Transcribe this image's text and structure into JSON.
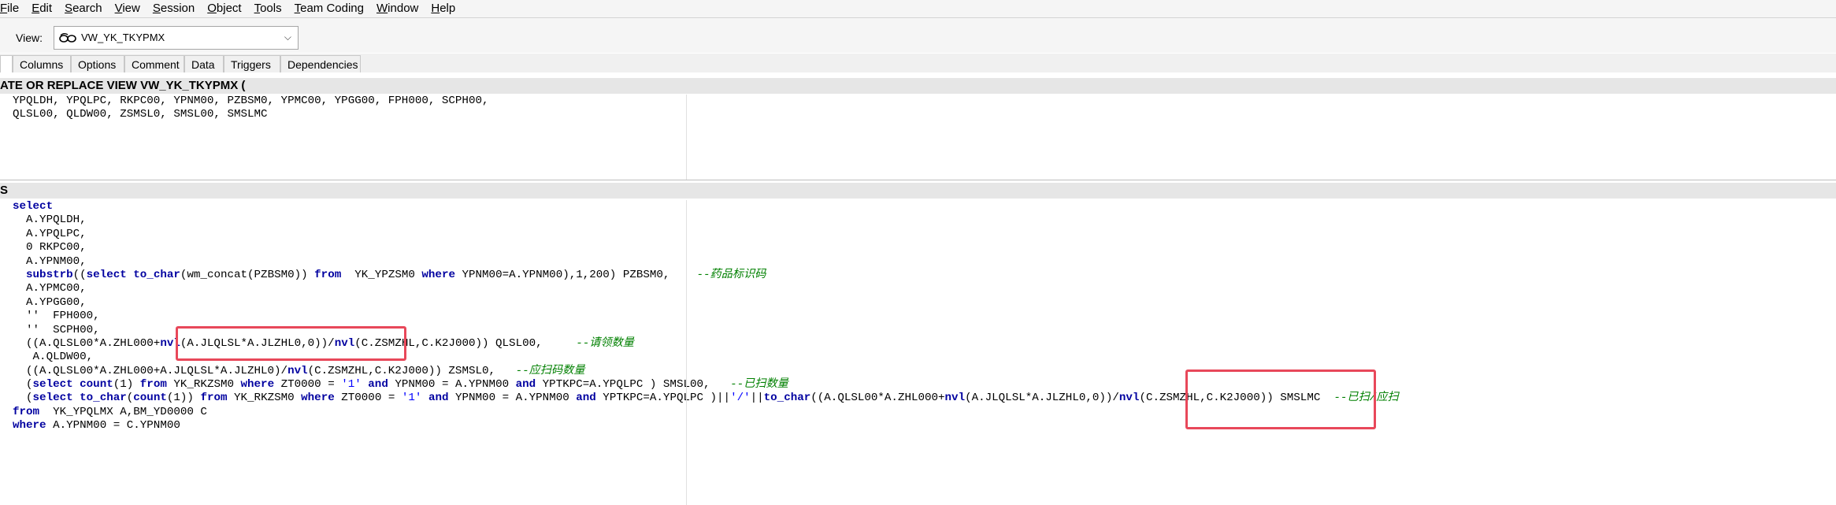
{
  "menu": [
    "File",
    "Edit",
    "Search",
    "View",
    "Session",
    "Object",
    "Tools",
    "Team Coding",
    "Window",
    "Help"
  ],
  "view": {
    "label": "View:",
    "selected": "VW_YK_TKYPMX",
    "icon": "glasses-icon",
    "arrow": "chevron-down-icon"
  },
  "tabs": [
    "Columns",
    "Options",
    "Comment",
    "Data",
    "Triggers",
    "Dependencies"
  ],
  "header_pane": {
    "title": "ATE OR REPLACE VIEW VW_YK_TKYPMX (",
    "lines": [
      "YPQLDH, YPQLPC, RKPC00, YPNM00, PZBSM0, YPMC00, YPGG00, FPH000, SCPH00,",
      "QLSL00, QLDW00, ZSMSL0, SMSL00, SMSLMC"
    ]
  },
  "body_pane": {
    "title": "S"
  },
  "code": {
    "l1": "select",
    "l2": "  A.YPQLDH,",
    "l3": "  A.YPQLPC,",
    "l4": "  0 RKPC00,",
    "l5": "  A.YPNM00,",
    "l6a": "substrb",
    "l6b": "((",
    "l6c": "select",
    "l6d": " ",
    "l6e": "to_char",
    "l6f": "(wm_concat(PZBSM0)) ",
    "l6g": "from",
    "l6h": "  YK_YPZSM0 ",
    "l6i": "where",
    "l6j": " YPNM00=A.YPNM00),1,200) PZBSM0,    ",
    "l6k": "--药品标识码",
    "l7": "  A.YPMC00,",
    "l8": "  A.YPGG00,",
    "l9": "  ''  FPH000,",
    "l10": "  ''  SCPH00,",
    "l11a": "  ((A.QLSL00*A.ZHL000+",
    "l11b": "nvl",
    "l11c": "(A.JLQLSL*A.JLZHL0,0))/",
    "l11d": "nvl",
    "l11e": "(C.ZSMZHL,C.K2J000)) QLSL00,     ",
    "l11f": "--请领数量",
    "l12": "   A.QLDW00,",
    "l13a": "  ((A.QLSL00*A.ZHL000+A.JLQLSL*A.JLZHL0)/",
    "l13b": "nvl",
    "l13c": "(C.ZSMZHL,C.K2J000)) ZSMSL0,   ",
    "l13d": "--应扫码数量",
    "l14a": "  (",
    "l14b": "select",
    "l14c": " ",
    "l14d": "count",
    "l14e": "(1) ",
    "l14f": "from",
    "l14g": " YK_RKZSM0 ",
    "l14h": "where",
    "l14i": " ZT0000 = ",
    "l14j": "'1'",
    "l14k": " ",
    "l14l": "and",
    "l14m": " YPNM00 = A.YPNM00 ",
    "l14n": "and",
    "l14o": " YPTKPC=A.YPQLPC ) SMSL00,   ",
    "l14p": "--已扫数量",
    "l15a": "  (",
    "l15b": "select",
    "l15c": " ",
    "l15d": "to_char",
    "l15e": "(",
    "l15f": "count",
    "l15g": "(1)) ",
    "l15h": "from",
    "l15i": " YK_RKZSM0 ",
    "l15j": "where",
    "l15k": " ZT0000 = ",
    "l15l": "'1'",
    "l15m": " ",
    "l15n": "and",
    "l15o": " YPNM00 = A.YPNM00 ",
    "l15p": "and",
    "l15q": " YPTKPC=A.YPQLPC )||",
    "l15r": "'/'",
    "l15s": "||",
    "l15t": "to_char",
    "l15u": "((A.QLSL00*A.ZHL000+",
    "l15v": "nvl",
    "l15w": "(A.JLQLSL*A.JLZHL0,0))/",
    "l15x": "nvl",
    "l15y": "(C.ZSMZHL,C.K2J000)) SMSLMC  ",
    "l15z": "--已扫/应扫",
    "l16a": "from",
    "l16b": "  YK_YPQLMX A,BM_YD0000 C",
    "l17a": "where",
    "l17b": " A.YPNM00 = C.YPNM00"
  },
  "colors": {
    "keyword": "#0000a0",
    "comment": "#008000",
    "string": "#0000ff",
    "highlight": "#e8485a"
  }
}
